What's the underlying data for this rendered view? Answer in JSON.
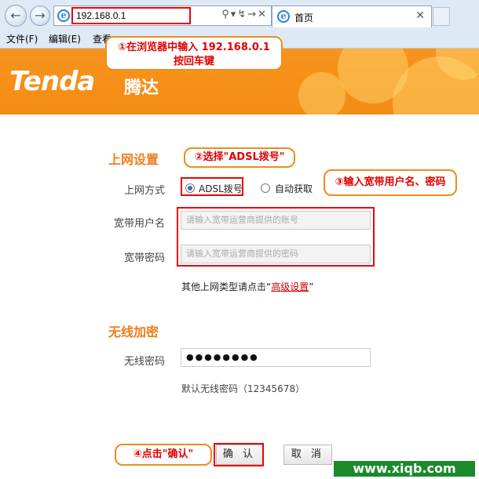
{
  "browser": {
    "url": "192.168.0.1",
    "tab_title": "首页",
    "menu": [
      "文件(F)",
      "编辑(E)",
      "查看"
    ]
  },
  "header": {
    "logo": "Tenda",
    "logo_cn": "腾达"
  },
  "form": {
    "internet_title": "上网设置",
    "mode_label": "上网方式",
    "mode_options": [
      "ADSL拨号",
      "自动获取"
    ],
    "mode_selected": "ADSL拨号",
    "user_label": "宽带用户名",
    "user_placeholder": "请输入宽带运营商提供的账号",
    "pass_label": "宽带密码",
    "pass_placeholder": "请输入宽带运营商提供的密码",
    "hint_prefix": "其他上网类型请点击“",
    "hint_link": "高级设置",
    "hint_suffix": "”",
    "wifi_title": "无线加密",
    "wifi_label": "无线密码",
    "wifi_value": "●●●●●●●●",
    "wifi_hint": "默认无线密码（12345678）",
    "confirm_button": "确 认",
    "cancel_button": "取 消"
  },
  "annotations": {
    "step1_line1": "①在浏览器中输入 192.168.0.1",
    "step1_line2": "按回车键",
    "step2": "②选择\"ADSL拨号\"",
    "step3": "③输入宽带用户名、密码",
    "step4": "④点击\"确认\"",
    "watermark": "www.xiqb.com",
    "annotation_color": "#e00000",
    "accent_color": "#f7941d"
  }
}
